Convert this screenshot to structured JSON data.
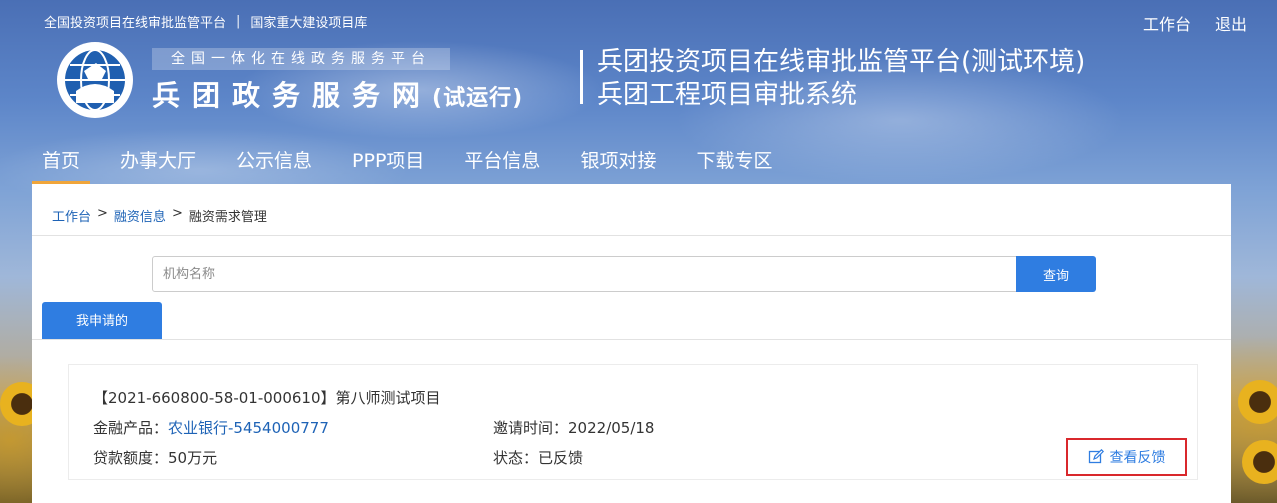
{
  "header": {
    "top_links": [
      "全国投资项目在线审批监管平台",
      "国家重大建设项目库"
    ],
    "top_sep": "|",
    "workbench": "工作台",
    "logout": "退出",
    "slogan": "全国一体化在线政务服务平台",
    "site_name": "兵团政务服务网",
    "site_suffix": "(试运行)",
    "system_title_line1": "兵团投资项目在线审批监管平台(测试环境)",
    "system_title_line2": "兵团工程项目审批系统"
  },
  "nav": {
    "items": [
      "首页",
      "办事大厅",
      "公示信息",
      "PPP项目",
      "平台信息",
      "银项对接",
      "下载专区"
    ],
    "active": "首页"
  },
  "breadcrumb": {
    "items": [
      "工作台",
      "融资信息",
      "融资需求管理"
    ],
    "sep": ">"
  },
  "search": {
    "placeholder": "机构名称",
    "button": "查询"
  },
  "tabs": {
    "mine": "我申请的"
  },
  "card": {
    "title": "【2021-660800-58-01-000610】第八师测试项目",
    "product_label": "金融产品：",
    "product_value": "农业银行-5454000777",
    "amount_label": "贷款额度：",
    "amount_value": "50万元",
    "invite_label": "邀请时间：",
    "invite_value": "2022/05/18",
    "status_label": "状态：",
    "status_value": "已反馈",
    "feedback_button": "查看反馈"
  },
  "colors": {
    "primary": "#2f7de1",
    "link": "#1e63b6",
    "nav_active_underline": "#f0a53a",
    "highlight_border": "#d9282c"
  },
  "icons": {
    "feedback": "edit-icon",
    "logo": "globe-logo-icon"
  }
}
